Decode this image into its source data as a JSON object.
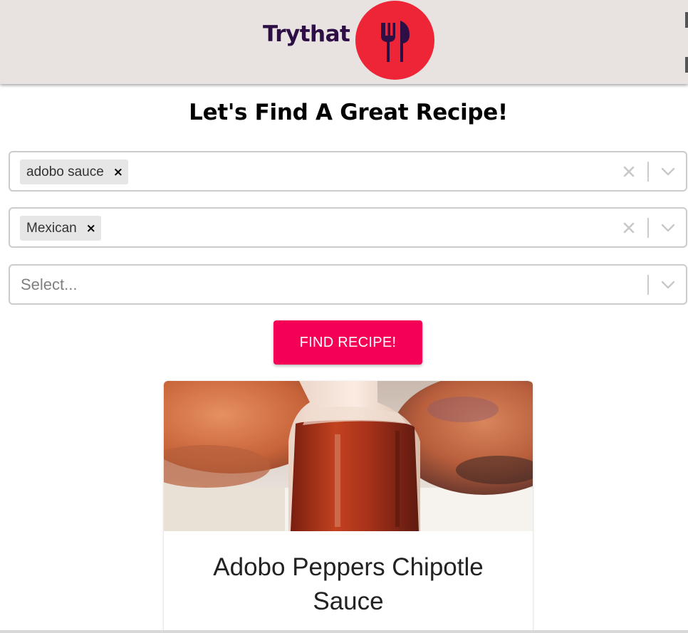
{
  "header": {
    "brand_name": "Trythat",
    "logo_icon": "fork-and-knife-icon",
    "logo_color": "#ee2437",
    "background": "#e8e3e1"
  },
  "main": {
    "title": "Let's Find A Great Recipe!"
  },
  "filters": {
    "ingredients": {
      "chips": [
        {
          "label": "adobo sauce",
          "remove_icon": "×"
        }
      ],
      "clear_icon": "clear-icon",
      "dropdown_icon": "chevron-down-icon"
    },
    "cuisine": {
      "chips": [
        {
          "label": "Mexican",
          "remove_icon": "×"
        }
      ],
      "clear_icon": "clear-icon",
      "dropdown_icon": "chevron-down-icon"
    },
    "third": {
      "placeholder": "Select...",
      "dropdown_icon": "chevron-down-icon"
    }
  },
  "actions": {
    "find_label": "FIND RECIPE!",
    "accent": "#f50057"
  },
  "results": [
    {
      "title": "Adobo Peppers Chipotle Sauce",
      "image": "bottle-of-chipotle-sauce-photo"
    }
  ]
}
